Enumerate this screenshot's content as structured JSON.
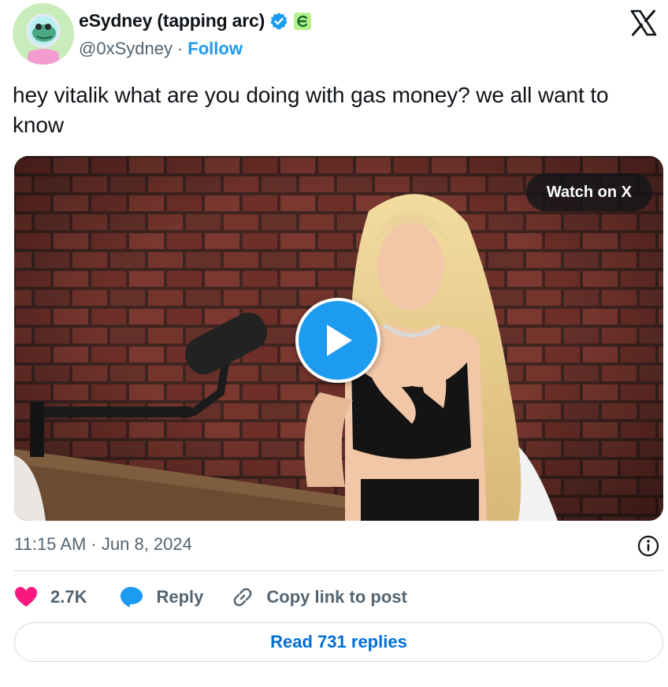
{
  "author": {
    "display_name": "eSydney (tapping arc)",
    "handle": "@0xSydney",
    "separator": "·",
    "follow_label": "Follow"
  },
  "icons": {
    "avatar": "frog-avatar-icon",
    "verified": "verified-badge-icon",
    "affiliate": "affiliate-badge-icon",
    "platform": "x-logo-icon",
    "play": "play-icon",
    "info": "info-icon",
    "like": "heart-icon",
    "reply": "speech-bubble-icon",
    "copy": "link-icon"
  },
  "tweet": {
    "text": "hey vitalik what are you doing with gas money? we all want to know",
    "timestamp": "11:15 AM · Jun 8, 2024"
  },
  "media": {
    "watch_label": "Watch on X"
  },
  "actions": {
    "like_count": "2.7K",
    "reply_label": "Reply",
    "copy_label": "Copy link to post",
    "read_replies_label": "Read 731 replies"
  },
  "colors": {
    "accent": "#1d9bf0",
    "like": "#f91880",
    "link": "#006fd6",
    "muted": "#536471",
    "text": "#0f1419"
  }
}
